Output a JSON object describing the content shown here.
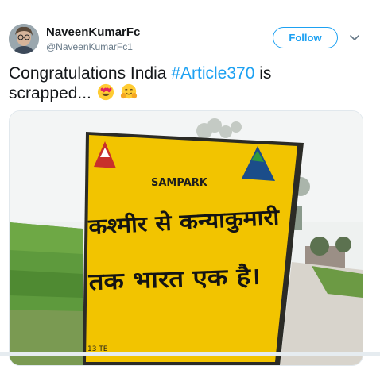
{
  "user": {
    "display_name": "NaveenKumarFc",
    "handle": "@NaveenKumarFc1",
    "avatar_icon": "profile-photo"
  },
  "follow_button": {
    "label": "Follow"
  },
  "tweet": {
    "text_before": "Congratulations India ",
    "hashtag": "#Article370",
    "text_after": " is scrapped...",
    "emojis": [
      "heart-eyes-emoji",
      "hugging-face-emoji"
    ]
  },
  "media": {
    "sign": {
      "header": "SAMPARK",
      "line1": "कश्मीर से कन्याकुमारी",
      "line2": "तक भारत एक है।",
      "footer": "13 TE"
    }
  },
  "colors": {
    "accent": "#1da1f2",
    "text": "#14171a",
    "secondary": "#657786",
    "sign_yellow": "#f2c400"
  }
}
